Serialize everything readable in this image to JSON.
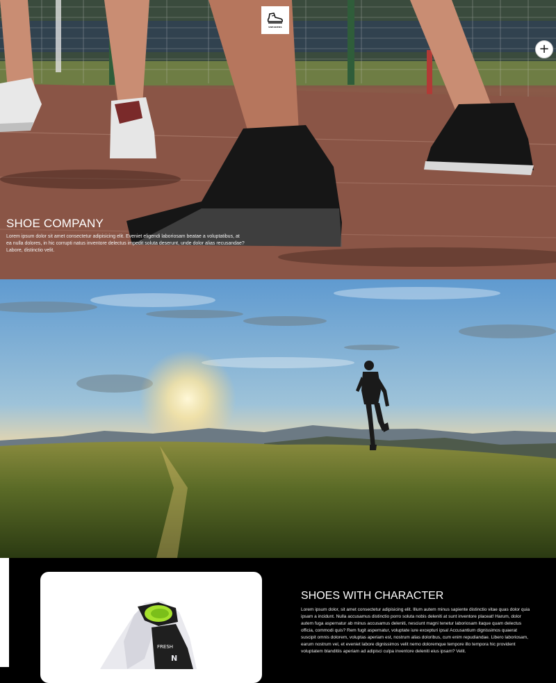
{
  "brand": {
    "logo_icon": "sneaker-icon",
    "logo_text": "SNEAKERS"
  },
  "header": {
    "menu_icon": "plus-icon",
    "menu_label": "+"
  },
  "hero": {
    "title": "SHOE COMPANY",
    "text": "Lorem ipsum dolor sit amet consectetur adipisicing elit. Eveniet eligendi laboriosam beatae a voluptatibus, at ea nulla dolores, in hic corrupti natus inventore delectus impedit soluta deserunt, unde dolor alias recusandae? Labore, distinctio velit."
  },
  "feature": {
    "title": "SHOES WITH CHARACTER",
    "text": "Lorem ipsum dolor, sit amet consectetur adipisicing elit. Illum autem minus sapiente distinctio vitae quas dolor quia ipsam a incidunt. Nulla accusamus distinctio porro soluta nobis deleniti at sunt inventore placeat! Harum, dolor autem fuga aspernatur ab minus accusamus deleniti, nesciunt magni tenetur laboriosam itaque quam delectus officia, commodi quis? Rem fugit aspernatur, voluptate iure excepturi ipsa! Accusantium dignissimos quaerat suscipit omnis dolorem, voluptas aperiam est, nostrum alias doloribus, cum enim repudiandae. Libero laboriosam, earum nostrum vel, et eveniet labore dignissimos velit nemo doloremque tempore illo tempora hic provident voluptatem blanditiis aperiam ad adipisci culpa inventore deleniti eius ipsam? Velit."
  },
  "colors": {
    "background": "#000000",
    "text": "#ffffff",
    "track": "#7a4b3d",
    "sky": "#8fb6cf"
  }
}
